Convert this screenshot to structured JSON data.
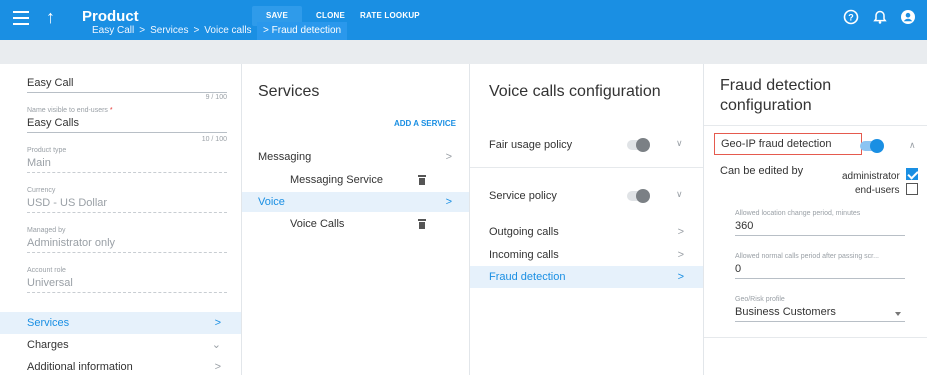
{
  "header": {
    "title": "Product",
    "save_label": "SAVE",
    "clone_label": "CLONE",
    "rate_label": "RATE LOOKUP",
    "breadcrumb": [
      "Easy Call",
      "Services",
      "Voice calls",
      "Fraud detection"
    ]
  },
  "general": {
    "name_value": "Easy Call",
    "name_count": "9 / 100",
    "visible_name_label": "Name visible to end-users",
    "visible_name_required": "*",
    "visible_name_value": "Easy Calls",
    "visible_name_count": "10 / 100",
    "product_type_label": "Product type",
    "product_type_value": "Main",
    "currency_label": "Currency",
    "currency_value": "USD - US Dollar",
    "managed_by_label": "Managed by",
    "managed_by_value": "Administrator only",
    "account_role_label": "Account role",
    "account_role_value": "Universal"
  },
  "left_nav": [
    {
      "label": "Services",
      "active": true
    },
    {
      "label": "Charges"
    },
    {
      "label": "Additional information"
    }
  ],
  "services": {
    "title": "Services",
    "add_label": "ADD A SERVICE",
    "items": [
      {
        "label": "Messaging"
      },
      {
        "label": "Messaging Service"
      },
      {
        "label": "Voice"
      },
      {
        "label": "Voice Calls"
      }
    ]
  },
  "voice_config": {
    "title": "Voice calls configuration",
    "fair_usage_label": "Fair usage policy",
    "service_policy_label": "Service policy",
    "items": [
      {
        "label": "Outgoing calls"
      },
      {
        "label": "Incoming calls"
      },
      {
        "label": "Fraud detection"
      }
    ]
  },
  "fraud": {
    "title_line1": "Fraud detection",
    "title_line2": "configuration",
    "geo_label": "Geo-IP fraud detection",
    "geo_enabled": true,
    "edit_by_label": "Can be edited by",
    "admin_label": "administrator",
    "admin_checked": true,
    "endusers_label": "end-users",
    "endusers_checked": false,
    "location_change_label": "Allowed location change period, minutes",
    "location_change_value": "360",
    "normal_calls_label": "Allowed normal calls period after passing scr...",
    "normal_calls_value": "0",
    "risk_profile_label": "Geo/Risk profile",
    "risk_profile_value": "Business Customers"
  },
  "colors": {
    "accent": "#1a8fe3",
    "header_bg": "#1a8fe3",
    "highlight_border": "#e55a4e",
    "active_row_bg": "#e6f1fb"
  }
}
